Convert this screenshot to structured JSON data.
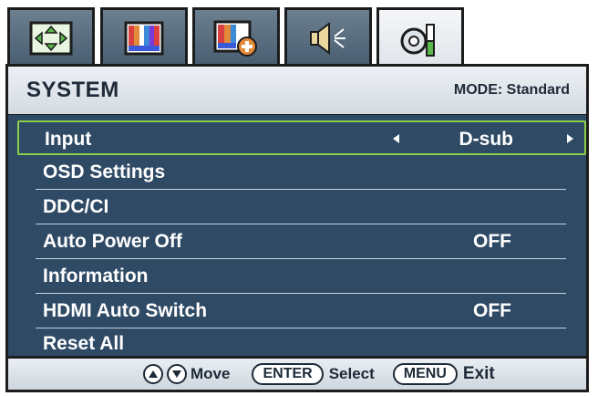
{
  "tabs": [
    {
      "icon": "display-adjust-icon",
      "active": false
    },
    {
      "icon": "picture-icon",
      "active": false
    },
    {
      "icon": "picture-advanced-icon",
      "active": false
    },
    {
      "icon": "audio-icon",
      "active": false
    },
    {
      "icon": "system-settings-icon",
      "active": true
    }
  ],
  "header": {
    "title": "SYSTEM",
    "mode": "MODE: Standard"
  },
  "menu": {
    "items": [
      {
        "label": "Input",
        "value": "D-sub",
        "selected": true
      },
      {
        "label": "OSD Settings",
        "value": ""
      },
      {
        "label": "DDC/CI",
        "value": ""
      },
      {
        "label": "Auto Power Off",
        "value": "OFF"
      },
      {
        "label": "Information",
        "value": ""
      },
      {
        "label": "HDMI Auto Switch",
        "value": "OFF"
      },
      {
        "label": "Reset All",
        "value": ""
      }
    ]
  },
  "footer": {
    "move": "Move",
    "enter": "ENTER",
    "select": "Select",
    "menu": "MENU",
    "exit": "Exit"
  },
  "colors": {
    "menu_bg": "#2f4a65",
    "highlight": "#8ccf4a",
    "header_text": "#1e2a38"
  }
}
